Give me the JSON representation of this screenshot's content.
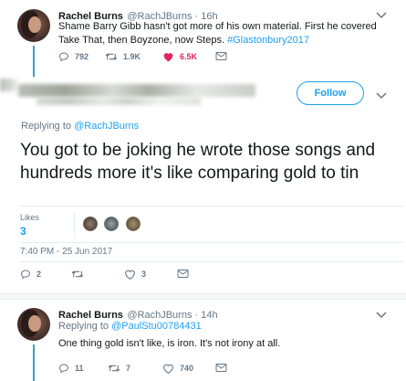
{
  "tweet1": {
    "name": "Rachel Burns",
    "handle": "@RachJBurns · 16h",
    "text_prefix": "Shame Barry Gibb hasn't got more of his own material. First he covered Take That, then Boyzone, now Steps. ",
    "hashtag": "#Glastonbury2017",
    "replies": "792",
    "retweets": "1.9K",
    "likes": "6.5K",
    "colors": {
      "like": "#e0245e",
      "accent": "#1da1f2"
    }
  },
  "main_tweet": {
    "follow_label": "Follow",
    "replying_prefix": "Replying to ",
    "replying_handle": "@RachJBurns",
    "text": "You got to be joking he wrote those songs and hundreds more it's like comparing gold to tin",
    "likes_label": "Likes",
    "likes_count": "3",
    "timestamp": "7:40 PM - 25 Jun 2017",
    "replies": "2",
    "retweets": "",
    "likes": "3"
  },
  "tweet2": {
    "name": "Rachel Burns",
    "handle": "@RachJBurns · 14h",
    "replying_prefix": "Replying to ",
    "replying_handle": "@PaulStu00784431",
    "text": "One thing gold isn't like, is iron. It's not irony at all.",
    "replies": "11",
    "retweets": "7",
    "likes": "740"
  }
}
